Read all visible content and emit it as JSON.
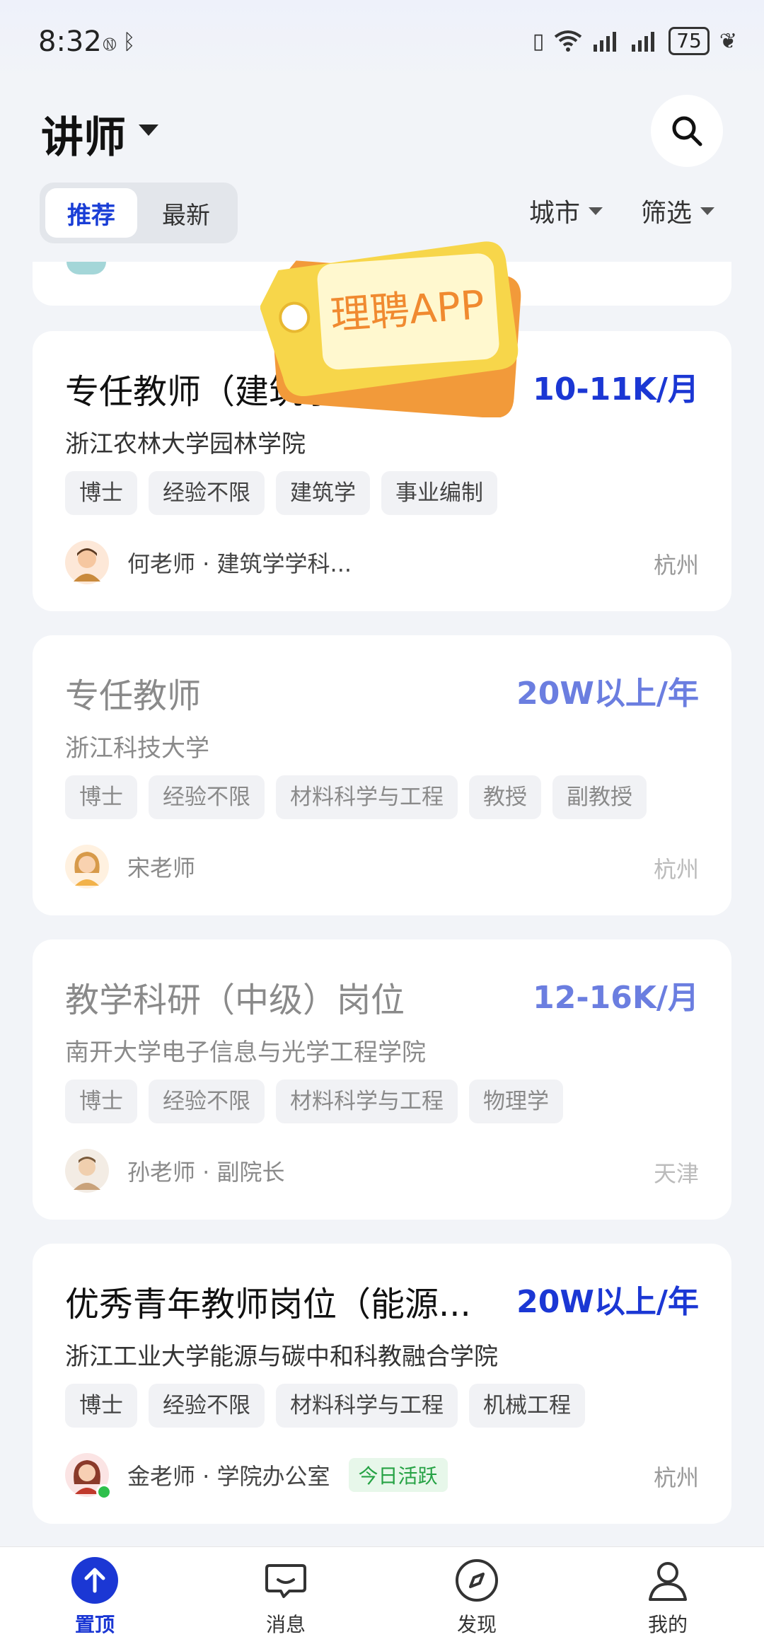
{
  "status_bar": {
    "time": "8:32",
    "battery": "75",
    "left_icons": [
      "nfc-icon",
      "bluetooth-icon"
    ],
    "right_icons": [
      "vibrate-icon",
      "wifi-icon",
      "signal-icon",
      "signal-icon",
      "battery-icon",
      "leaf-icon"
    ]
  },
  "header": {
    "title": "讲师",
    "tabs": [
      {
        "label": "推荐",
        "active": true
      },
      {
        "label": "最新",
        "active": false
      }
    ],
    "filters": {
      "city": "城市",
      "filter": "筛选"
    }
  },
  "watermark": {
    "text": "理聘APP"
  },
  "jobs": [
    {
      "title": "专任教师（建筑学）",
      "salary": "10-11K/月",
      "company": "浙江农林大学园林学院",
      "tags": [
        "博士",
        "经验不限",
        "建筑学",
        "事业编制"
      ],
      "contact": "何老师 · 建筑学学科...",
      "city": "杭州"
    },
    {
      "title": "专任教师",
      "salary": "20W以上/年",
      "company": "浙江科技大学",
      "tags": [
        "博士",
        "经验不限",
        "材料科学与工程",
        "教授",
        "副教授"
      ],
      "contact": "宋老师",
      "city": "杭州"
    },
    {
      "title": "教学科研（中级）岗位",
      "salary": "12-16K/月",
      "company": "南开大学电子信息与光学工程学院",
      "tags": [
        "博士",
        "经验不限",
        "材料科学与工程",
        "物理学"
      ],
      "contact": "孙老师 · 副院长",
      "city": "天津"
    },
    {
      "title": "优秀青年教师岗位（能源...",
      "salary": "20W以上/年",
      "company": "浙江工业大学能源与碳中和科教融合学院",
      "tags": [
        "博士",
        "经验不限",
        "材料科学与工程",
        "机械工程"
      ],
      "contact": "金老师 · 学院办公室",
      "badge": "今日活跃",
      "city": "杭州"
    }
  ],
  "bottom_nav": [
    {
      "label": "置顶",
      "icon": "arrow-up-icon",
      "active": true
    },
    {
      "label": "消息",
      "icon": "message-icon",
      "active": false
    },
    {
      "label": "发现",
      "icon": "compass-icon",
      "active": false
    },
    {
      "label": "我的",
      "icon": "profile-icon",
      "active": false
    }
  ],
  "colors": {
    "accent": "#1b37d4",
    "active_green": "#25a244",
    "background": "#f2f4f8"
  }
}
